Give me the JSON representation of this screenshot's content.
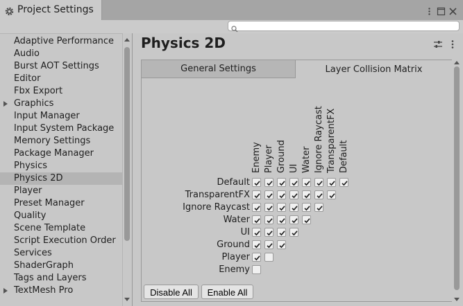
{
  "window": {
    "title": "Project Settings",
    "icons": [
      "gear-icon",
      "more-icon",
      "maximize-icon",
      "close-icon"
    ]
  },
  "search": {
    "placeholder": "",
    "icon": "search-icon"
  },
  "sidebar": {
    "selected": "Physics 2D",
    "items": [
      {
        "label": "Adaptive Performance",
        "expandable": false
      },
      {
        "label": "Audio",
        "expandable": false
      },
      {
        "label": "Burst AOT Settings",
        "expandable": false
      },
      {
        "label": "Editor",
        "expandable": false
      },
      {
        "label": "Fbx Export",
        "expandable": false
      },
      {
        "label": "Graphics",
        "expandable": true
      },
      {
        "label": "Input Manager",
        "expandable": false
      },
      {
        "label": "Input System Package",
        "expandable": false
      },
      {
        "label": "Memory Settings",
        "expandable": false
      },
      {
        "label": "Package Manager",
        "expandable": false
      },
      {
        "label": "Physics",
        "expandable": false
      },
      {
        "label": "Physics 2D",
        "expandable": false
      },
      {
        "label": "Player",
        "expandable": false
      },
      {
        "label": "Preset Manager",
        "expandable": false
      },
      {
        "label": "Quality",
        "expandable": false
      },
      {
        "label": "Scene Template",
        "expandable": false
      },
      {
        "label": "Script Execution Order",
        "expandable": false
      },
      {
        "label": "Services",
        "expandable": false
      },
      {
        "label": "ShaderGraph",
        "expandable": false
      },
      {
        "label": "Tags and Layers",
        "expandable": false
      },
      {
        "label": "TextMesh Pro",
        "expandable": true
      }
    ]
  },
  "main": {
    "title": "Physics 2D",
    "tabs": [
      "General Settings",
      "Layer Collision Matrix"
    ],
    "active_tab": "Layer Collision Matrix"
  },
  "matrix": {
    "columns": [
      "Enemy",
      "Player",
      "Ground",
      "UI",
      "Water",
      "Ignore Raycast",
      "TransparentFX",
      "Default"
    ],
    "rows": [
      {
        "label": "Default",
        "checks": [
          true,
          true,
          true,
          true,
          true,
          true,
          true,
          true
        ]
      },
      {
        "label": "TransparentFX",
        "checks": [
          true,
          true,
          true,
          true,
          true,
          true,
          true
        ]
      },
      {
        "label": "Ignore Raycast",
        "checks": [
          true,
          true,
          true,
          true,
          true,
          true
        ]
      },
      {
        "label": "Water",
        "checks": [
          true,
          true,
          true,
          true,
          true
        ]
      },
      {
        "label": "UI",
        "checks": [
          true,
          true,
          true,
          true
        ]
      },
      {
        "label": "Ground",
        "checks": [
          true,
          true,
          true
        ]
      },
      {
        "label": "Player",
        "checks": [
          true,
          false
        ]
      },
      {
        "label": "Enemy",
        "checks": [
          false
        ]
      }
    ]
  },
  "buttons": {
    "disable_all": "Disable All",
    "enable_all": "Enable All"
  }
}
